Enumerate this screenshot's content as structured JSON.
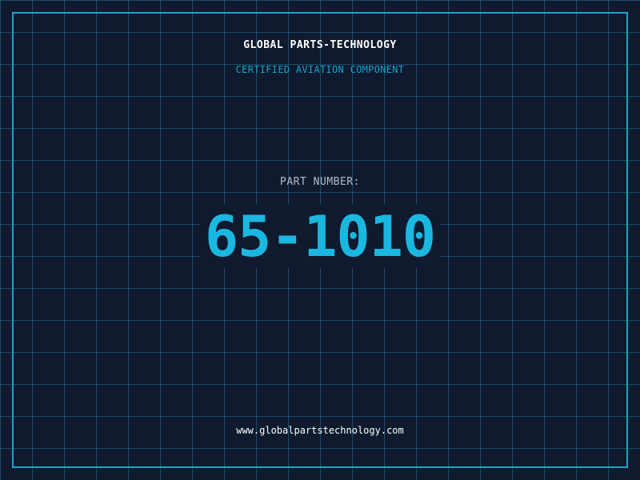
{
  "header": {
    "company": "GLOBAL PARTS-TECHNOLOGY",
    "subtitle": "CERTIFIED AVIATION COMPONENT"
  },
  "part": {
    "label": "PART NUMBER:",
    "number": "65-1010"
  },
  "footer": {
    "website": "www.globalpartstechnology.com"
  },
  "colors": {
    "background": "#0f1a2e",
    "grid": "#1e7896",
    "accent": "#1ab8e0",
    "text": "#ffffff",
    "muted": "#b4bccb"
  }
}
